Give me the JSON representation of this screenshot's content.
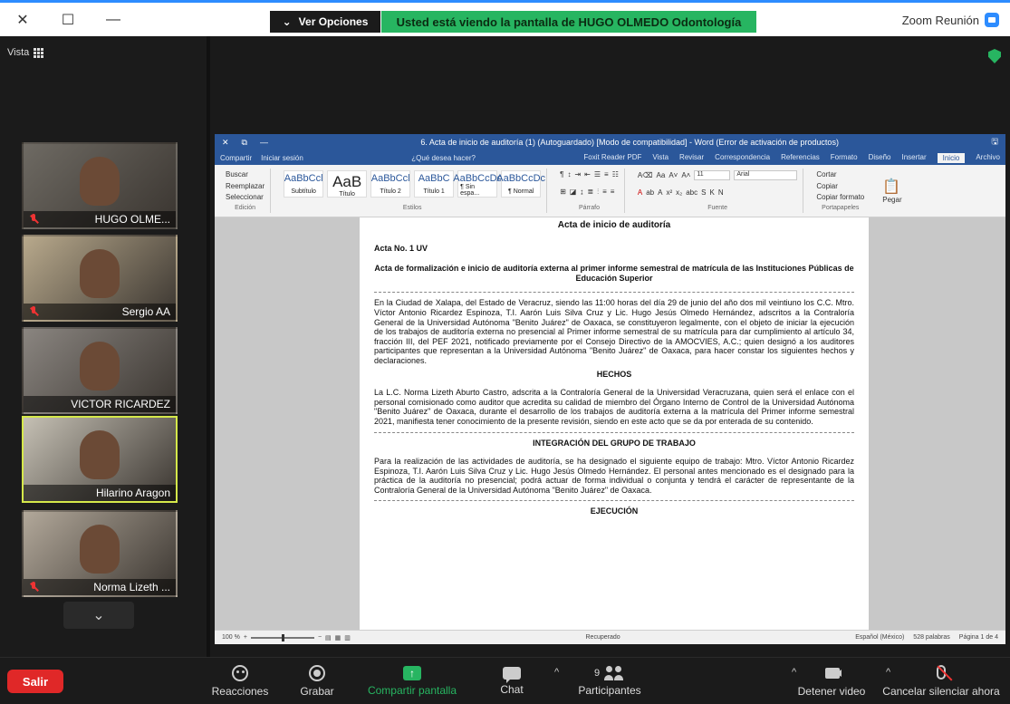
{
  "window": {
    "app_title": "Zoom Reunión",
    "share_dropdown": "Ver Opciones",
    "share_banner": "Usted está viendo la pantalla de HUGO OLMEDO Odontología",
    "controls": {
      "minimize": "—",
      "maximize": "☐",
      "close": "✕"
    }
  },
  "gallery": {
    "view_label": "Vista",
    "participants": [
      {
        "name": "HUGO OLME...",
        "muted": true,
        "active": false,
        "bg": "#6e6a63"
      },
      {
        "name": "Sergio AA",
        "muted": true,
        "active": false,
        "bg": "#b8a98c"
      },
      {
        "name": "VICTOR RICARDEZ",
        "muted": false,
        "active": false,
        "bg": "#8a8580"
      },
      {
        "name": "Hilarino Aragon",
        "muted": false,
        "active": true,
        "bg": "#c5c0b4"
      },
      {
        "name": "Norma Lizeth ...",
        "muted": true,
        "active": false,
        "bg": "#b2a89a"
      }
    ],
    "scroll_down_icon": "⌄"
  },
  "word": {
    "title": "6. Acta de inicio de auditoría (1) (Autoguardado) [Modo de compatibilidad] - Word (Error de activación de productos)",
    "title_controls": {
      "close": "✕",
      "restore": "⧉",
      "minimize": "—"
    },
    "share_label": "Compartir",
    "signin_label": "Iniciar sesión",
    "tell_me": "¿Qué desea hacer?",
    "tabs": [
      "Archivo",
      "Inicio",
      "Insertar",
      "Diseño",
      "Formato",
      "Referencias",
      "Correspondencia",
      "Revisar",
      "Vista",
      "Foxit Reader PDF"
    ],
    "active_tab": "Inicio",
    "ribbon": {
      "clipboard": {
        "paste": "Pegar",
        "cut": "Cortar",
        "copy": "Copiar",
        "format_painter": "Copiar formato",
        "label": "Portapapeles"
      },
      "font": {
        "name": "Arial",
        "size": "11",
        "label": "Fuente"
      },
      "paragraph": {
        "label": "Párrafo"
      },
      "styles": {
        "items": [
          {
            "sample": "AaBbCcDc",
            "name": "¶ Normal",
            "big": false
          },
          {
            "sample": "AaBbCcDc",
            "name": "¶ Sin espa...",
            "big": false
          },
          {
            "sample": "AaBbC",
            "name": "Título 1",
            "big": false
          },
          {
            "sample": "AaBbCcl",
            "name": "Título 2",
            "big": false
          },
          {
            "sample": "AaB",
            "name": "Título",
            "big": true
          },
          {
            "sample": "AaBbCcl",
            "name": "Subtítulo",
            "big": false
          }
        ],
        "label": "Estilos"
      },
      "editing": {
        "find": "Buscar",
        "replace": "Reemplazar",
        "select": "Seleccionar",
        "label": "Edición"
      }
    },
    "document": {
      "title": "Acta de inicio de auditoría",
      "acta_no": "Acta No. 1 UV",
      "heading": "Acta de formalización e inicio de auditoría externa al primer informe semestral de matrícula de las Instituciones Públicas de Educación Superior",
      "p1": "En la Ciudad de Xalapa, del Estado de Veracruz, siendo las 11:00 horas del día 29 de junio del año dos mil veintiuno los C.C. Mtro. Víctor Antonio Ricardez Espinoza, T.I. Aarón Luis Silva Cruz y Lic. Hugo Jesús Olmedo Hernández, adscritos a la Contraloría General de la Universidad Autónoma \"Benito Juárez\" de Oaxaca, se constituyeron legalmente, con el objeto de iniciar la ejecución de los trabajos de auditoría externa no presencial al Primer informe semestral de su matrícula para dar cumplimiento al artículo 34, fracción III, del PEF 2021, notificado previamente por el Consejo Directivo de la AMOCVIES, A.C.; quien designó a los auditores participantes que representan a la Universidad Autónoma \"Benito Juárez\" de Oaxaca, para hacer constar los siguientes hechos y declaraciones.",
      "hechos_heading": "HECHOS",
      "p2": "La L.C. Norma Lizeth Aburto Castro, adscrita a la Contraloría General de la Universidad Veracruzana, quien será el enlace con el personal comisionado como auditor que acredita su calidad de miembro del Órgano Interno de Control de la Universidad Autónoma \"Benito Juárez\" de Oaxaca, durante el desarrollo de los trabajos de auditoría externa a la matrícula del Primer informe semestral 2021, manifiesta tener conocimiento de la presente revisión, siendo en este acto que se da por enterada de su contenido.",
      "integ_heading": "INTEGRACIÓN DEL GRUPO DE TRABAJO",
      "p3": "Para la realización de las actividades de auditoría, se ha designado el siguiente equipo de trabajo: Mtro. Víctor Antonio Ricardez Espinoza, T.I. Aarón Luis Silva Cruz y Lic. Hugo Jesús Olmedo Hernández. El personal antes mencionado es el designado para la práctica de la auditoría no presencial; podrá actuar de forma individual o conjunta y tendrá el carácter de representante de la Contraloría General de la Universidad Autónoma \"Benito Juárez\" de Oaxaca.",
      "ejec_heading": "EJECUCIÓN"
    },
    "status": {
      "page": "Página 1 de 4",
      "words": "528 palabras",
      "language": "Español (México)",
      "recovered": "Recuperado",
      "zoom": "100 %"
    }
  },
  "toolbar": {
    "mute": "Cancelar silenciar ahora",
    "video": "Detener video",
    "participants": "Participantes",
    "participants_count": "9",
    "chat": "Chat",
    "share": "Compartir pantalla",
    "record": "Grabar",
    "reactions": "Reacciones",
    "leave": "Salir"
  },
  "colors": {
    "accent": "#2d8cff",
    "share_green": "#27b561",
    "leave_red": "#e02828",
    "active_speaker": "#d5e84a",
    "word_blue": "#2b579a"
  }
}
